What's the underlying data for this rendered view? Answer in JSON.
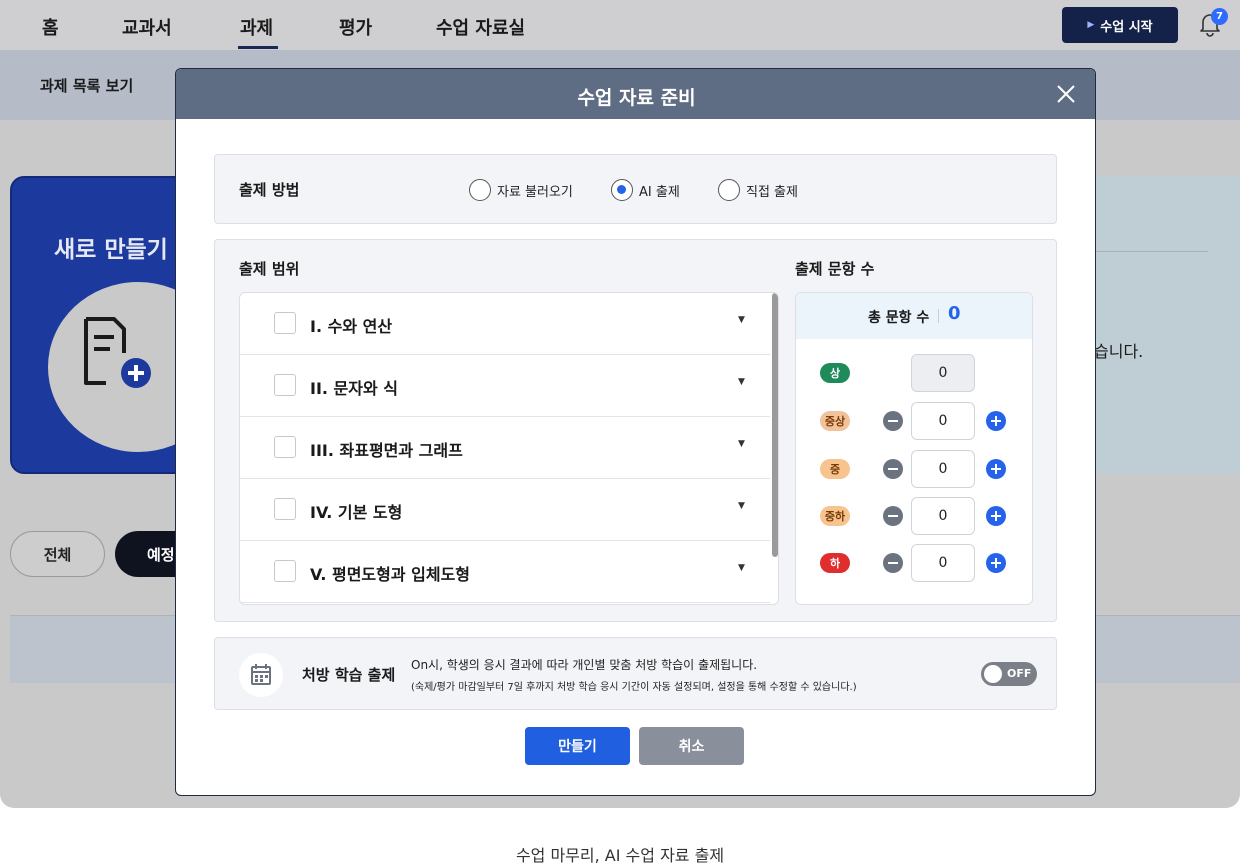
{
  "nav": {
    "items": [
      "홈",
      "교과서",
      "과제",
      "평가",
      "수업 자료실"
    ],
    "active_index": 2,
    "start_button": "수업 시작",
    "notification_count": "7"
  },
  "background": {
    "subbar_label": "과제 목록 보기",
    "card_title": "새로 만들기",
    "right_text": "습니다.",
    "filter_all": "전체",
    "filter_scheduled": "예정"
  },
  "modal": {
    "title": "수업 자료 준비",
    "method": {
      "label": "출제 방법",
      "options": [
        "자료 불러오기",
        "AI 출제",
        "직접 출제"
      ],
      "selected": "AI 출제"
    },
    "range": {
      "label": "출제 범위",
      "units": [
        "I. 수와 연산",
        "II. 문자와 식",
        "III. 좌표평면과 그래프",
        "IV. 기본 도형",
        "V. 평면도형과 입체도형"
      ]
    },
    "count": {
      "label": "출제 문항 수",
      "total_label": "총 문항 수",
      "total": "0",
      "levels": [
        {
          "name": "상",
          "value": "0",
          "color": "#1f8a5a",
          "text_color": "#ffffff"
        },
        {
          "name": "중상",
          "value": "0",
          "color": "#f2c29a",
          "text_color": "#7a3b08"
        },
        {
          "name": "중",
          "value": "0",
          "color": "#f7c48f",
          "text_color": "#7a3b08"
        },
        {
          "name": "중하",
          "value": "0",
          "color": "#f7c48f",
          "text_color": "#7a3b08"
        },
        {
          "name": "하",
          "value": "0",
          "color": "#e02d2d",
          "text_color": "#ffffff"
        }
      ]
    },
    "prescription": {
      "title": "처방 학습 출제",
      "desc1": "On시, 학생의 응시 결과에 따라 개인별 맞춤 처방 학습이 출제됩니다.",
      "desc2": "(숙제/평가 마감일부터 7일 후까지 처방 학습 응시 기간이 자동 설정되며, 설정을 통해 수정할 수 있습니다.)",
      "toggle": "OFF"
    },
    "buttons": {
      "make": "만들기",
      "cancel": "취소"
    }
  },
  "caption": "수업 마무리, AI 수업 자료 출제",
  "colors": {
    "primary": "#1f5fe0",
    "header": "#5f6d84",
    "navy": "#14224a"
  }
}
